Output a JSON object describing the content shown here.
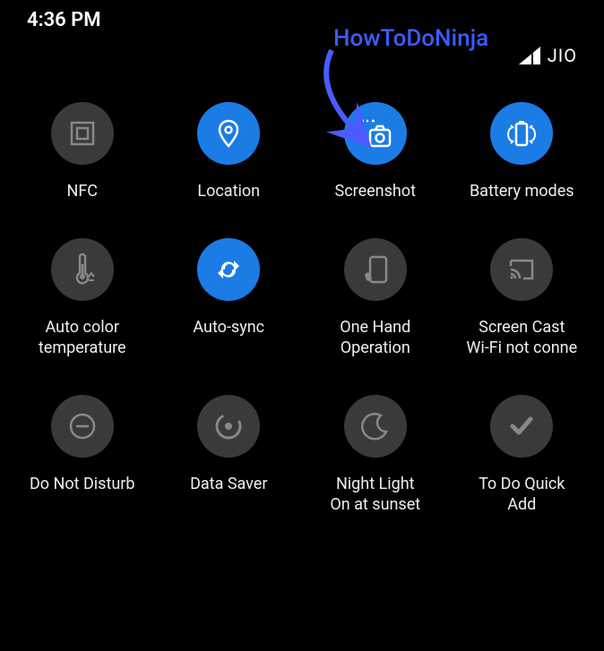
{
  "status": {
    "time": "4:36 PM",
    "carrier": "JIO"
  },
  "annotation": {
    "text": "HowToDoNinja"
  },
  "tiles": {
    "nfc": {
      "label": "NFC"
    },
    "location": {
      "label": "Location"
    },
    "screenshot": {
      "label": "Screenshot"
    },
    "battery": {
      "label": "Battery modes"
    },
    "autocolor": {
      "label": "Auto color\ntemperature"
    },
    "autosync": {
      "label": "Auto-sync"
    },
    "onehand": {
      "label": "One Hand\nOperation"
    },
    "screencast": {
      "label": "Screen Cast\nWi-Fi not conne"
    },
    "dnd": {
      "label": "Do Not Disturb"
    },
    "datasaver": {
      "label": "Data Saver"
    },
    "nightlight": {
      "label": "Night Light\nOn at sunset"
    },
    "todo": {
      "label": "To Do Quick\nAdd"
    }
  }
}
